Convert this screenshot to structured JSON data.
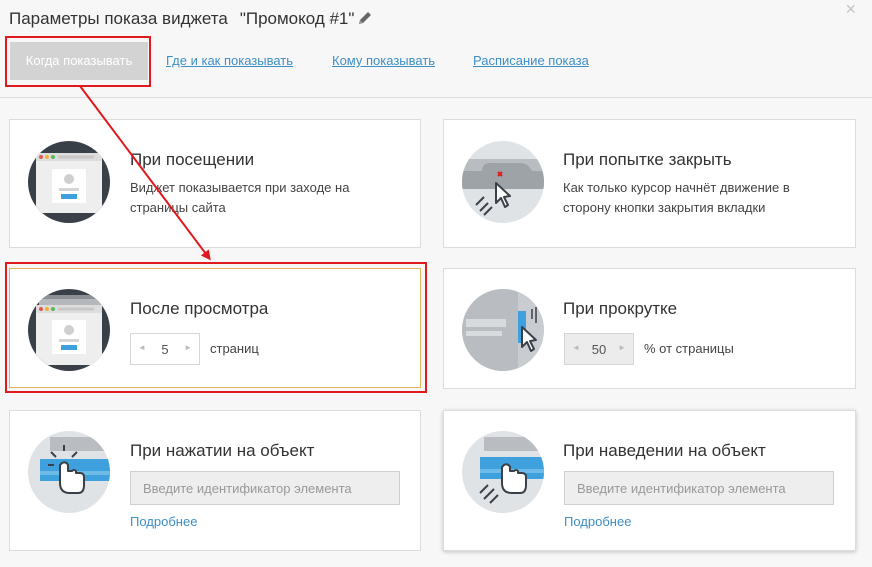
{
  "header": {
    "title": "Параметры показа виджета",
    "widget_name": "\"Промокод #1\"",
    "edit_icon": "pencil-icon",
    "close_label": "×"
  },
  "tabs": [
    {
      "label": "Когда показывать",
      "active": true
    },
    {
      "label": "Где и как показывать",
      "active": false
    },
    {
      "label": "Кому показывать",
      "active": false
    },
    {
      "label": "Расписание показа",
      "active": false
    }
  ],
  "cards": {
    "visit": {
      "title": "При посещении",
      "desc": "Виджет показывается при заходе на страницы сайта",
      "icon": "browser-page-icon"
    },
    "close_attempt": {
      "title": "При попытке закрыть",
      "desc": "Как только курсор начнёт движение в сторону кнопки закрытия вкладки",
      "icon": "cursor-close-tab-icon"
    },
    "after_view": {
      "title": "После просмотра",
      "value": "5",
      "unit": "страниц",
      "icon": "browser-pages-stack-icon"
    },
    "scroll": {
      "title": "При прокрутке",
      "value": "50",
      "unit": "% от страницы",
      "icon": "scroll-page-icon"
    },
    "click": {
      "title": "При нажатии на объект",
      "placeholder": "Введите идентификатор элемента",
      "more": "Подробнее",
      "icon": "click-element-icon"
    },
    "hover": {
      "title": "При наведении на объект",
      "placeholder": "Введите идентификатор элемента",
      "more": "Подробнее",
      "icon": "hover-element-icon"
    }
  },
  "stepper_arrows": {
    "left": "◄",
    "right": "►"
  },
  "colors": {
    "accent_link": "#3f8fc7",
    "highlight_red": "#e0191e",
    "icon_dark": "#3a4047",
    "icon_blue": "#3ea0dc"
  }
}
